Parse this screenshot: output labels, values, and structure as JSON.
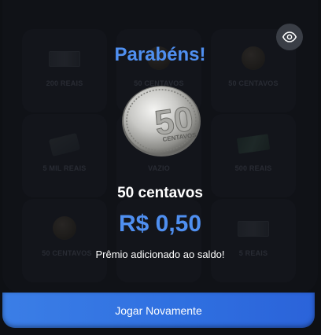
{
  "modal": {
    "title": "Parabéns!",
    "prize_name": "50 centavos",
    "prize_value": "R$ 0,50",
    "message": "Prêmio adicionado ao saldo!",
    "coin_face_text": "50",
    "coin_label": "CENTAVOS"
  },
  "grid": {
    "items": [
      {
        "label": "200 REAIS"
      },
      {
        "label": "50 CENTAVOS"
      },
      {
        "label": "50 CENTAVOS"
      },
      {
        "label": "5 MIL REAIS"
      },
      {
        "label": "VAZIO"
      },
      {
        "label": "500 REAIS"
      },
      {
        "label": "50 CENTAVOS"
      },
      {
        "label": ""
      },
      {
        "label": "5 REAIS"
      }
    ]
  },
  "actions": {
    "play_again_label": "Jogar Novamente",
    "toggle_visibility_icon": "eye-icon"
  },
  "colors": {
    "accent": "#4f8ff0",
    "button": "#3b7ee6",
    "background": "#14171d"
  }
}
